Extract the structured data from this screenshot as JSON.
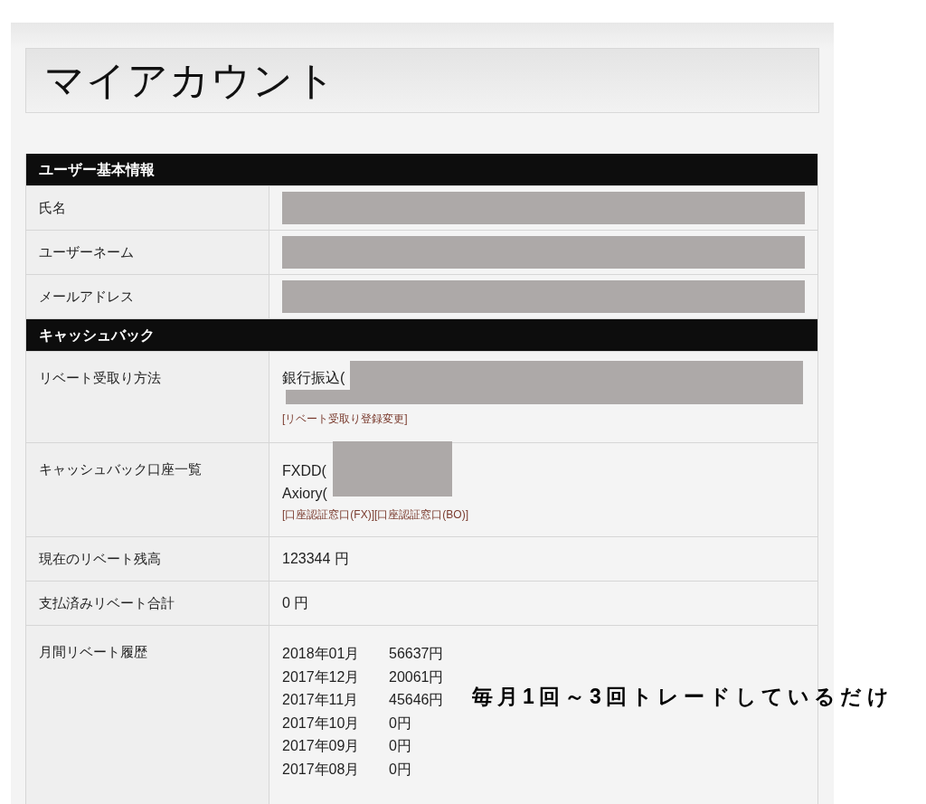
{
  "page_title": "マイアカウント",
  "sections": [
    {
      "title": "ユーザー基本情報",
      "rows": [
        {
          "label": "氏名",
          "kind": "redacted"
        },
        {
          "label": "ユーザーネーム",
          "kind": "redacted"
        },
        {
          "label": "メールアドレス",
          "kind": "redacted"
        }
      ]
    },
    {
      "title": "キャッシュバック",
      "rows": [
        {
          "label": "リベート受取り方法",
          "kind": "payout",
          "lines": [
            "銀行振込("
          ],
          "links": [
            "[リベート受取り登録変更]"
          ]
        },
        {
          "label": "キャッシュバック口座一覧",
          "kind": "accounts",
          "lines": [
            "FXDD(",
            "Axiory("
          ],
          "links": [
            "[口座認証窓口(FX)]",
            "[口座認証窓口(BO)]"
          ]
        },
        {
          "label": "現在のリベート残高",
          "kind": "text",
          "value": "123344 円"
        },
        {
          "label": "支払済みリベート合計",
          "kind": "text",
          "value": "0 円"
        },
        {
          "label": "月間リベート履歴",
          "kind": "history",
          "entries": [
            {
              "month": "2018年01月",
              "amount": "56637円"
            },
            {
              "month": "2017年12月",
              "amount": "20061円"
            },
            {
              "month": "2017年11月",
              "amount": "45646円"
            },
            {
              "month": "2017年10月",
              "amount": "0円"
            },
            {
              "month": "2017年09月",
              "amount": "0円"
            },
            {
              "month": "2017年08月",
              "amount": "0円"
            }
          ]
        }
      ]
    }
  ],
  "annotation": "毎月1回～3回トレードしているだけ"
}
